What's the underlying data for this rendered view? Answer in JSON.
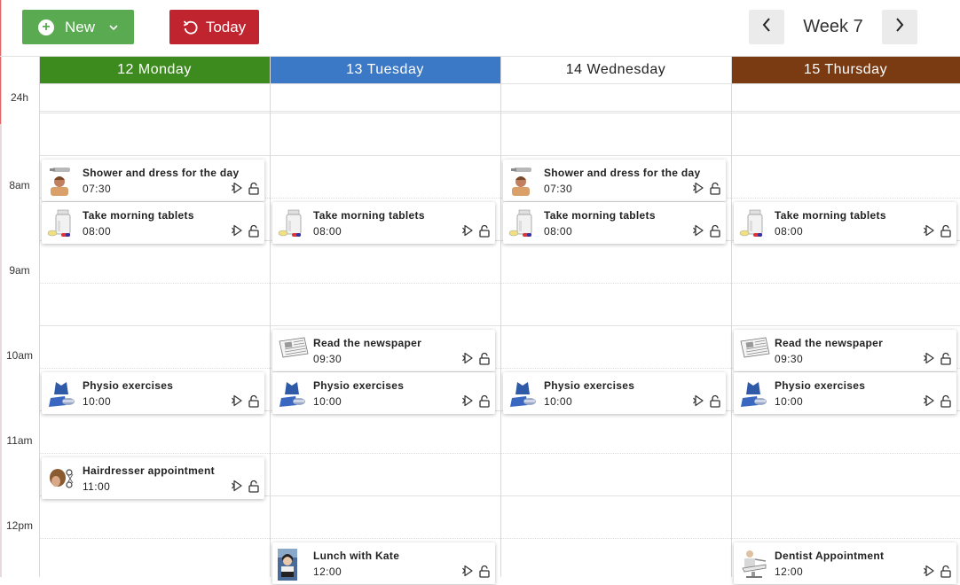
{
  "toolbar": {
    "new_label": "New",
    "today_label": "Today",
    "week_label": "Week 7",
    "new_color": "#5aaa52",
    "today_color": "#c0242e"
  },
  "days": [
    {
      "label": "12 Monday",
      "bg": "#3d8a1f",
      "fg": "#ffffff"
    },
    {
      "label": "13 Tuesday",
      "bg": "#3b78c6",
      "fg": "#ffffff"
    },
    {
      "label": "14 Wednesday",
      "bg": "#ffffff",
      "fg": "#222222"
    },
    {
      "label": "15 Thursday",
      "bg": "#7a3a12",
      "fg": "#ffffff"
    }
  ],
  "hours": [
    "24h",
    "8am",
    "9am",
    "10am",
    "11am",
    "12pm"
  ],
  "events": [
    {
      "day": 0,
      "title": "Shower and dress for the day",
      "time": "07:30",
      "icon": "shower-icon"
    },
    {
      "day": 0,
      "title": "Take morning tablets",
      "time": "08:00",
      "icon": "tablets-icon"
    },
    {
      "day": 0,
      "title": "Physio exercises",
      "time": "10:00",
      "icon": "physio-icon"
    },
    {
      "day": 0,
      "title": "Hairdresser appointment",
      "time": "11:00",
      "icon": "hairdresser-icon"
    },
    {
      "day": 1,
      "title": "Take morning tablets",
      "time": "08:00",
      "icon": "tablets-icon"
    },
    {
      "day": 1,
      "title": "Read the newspaper",
      "time": "09:30",
      "icon": "newspaper-icon"
    },
    {
      "day": 1,
      "title": "Physio exercises",
      "time": "10:00",
      "icon": "physio-icon"
    },
    {
      "day": 1,
      "title": "Lunch with Kate",
      "time": "12:00",
      "icon": "kate-photo-icon"
    },
    {
      "day": 2,
      "title": "Shower and dress for the day",
      "time": "07:30",
      "icon": "shower-icon"
    },
    {
      "day": 2,
      "title": "Take morning tablets",
      "time": "08:00",
      "icon": "tablets-icon"
    },
    {
      "day": 2,
      "title": "Physio exercises",
      "time": "10:00",
      "icon": "physio-icon"
    },
    {
      "day": 3,
      "title": "Take morning tablets",
      "time": "08:00",
      "icon": "tablets-icon"
    },
    {
      "day": 3,
      "title": "Read the newspaper",
      "time": "09:30",
      "icon": "newspaper-icon"
    },
    {
      "day": 3,
      "title": "Physio exercises",
      "time": "10:00",
      "icon": "physio-icon"
    },
    {
      "day": 3,
      "title": "Dentist Appointment",
      "time": "12:00",
      "icon": "dentist-icon"
    }
  ]
}
